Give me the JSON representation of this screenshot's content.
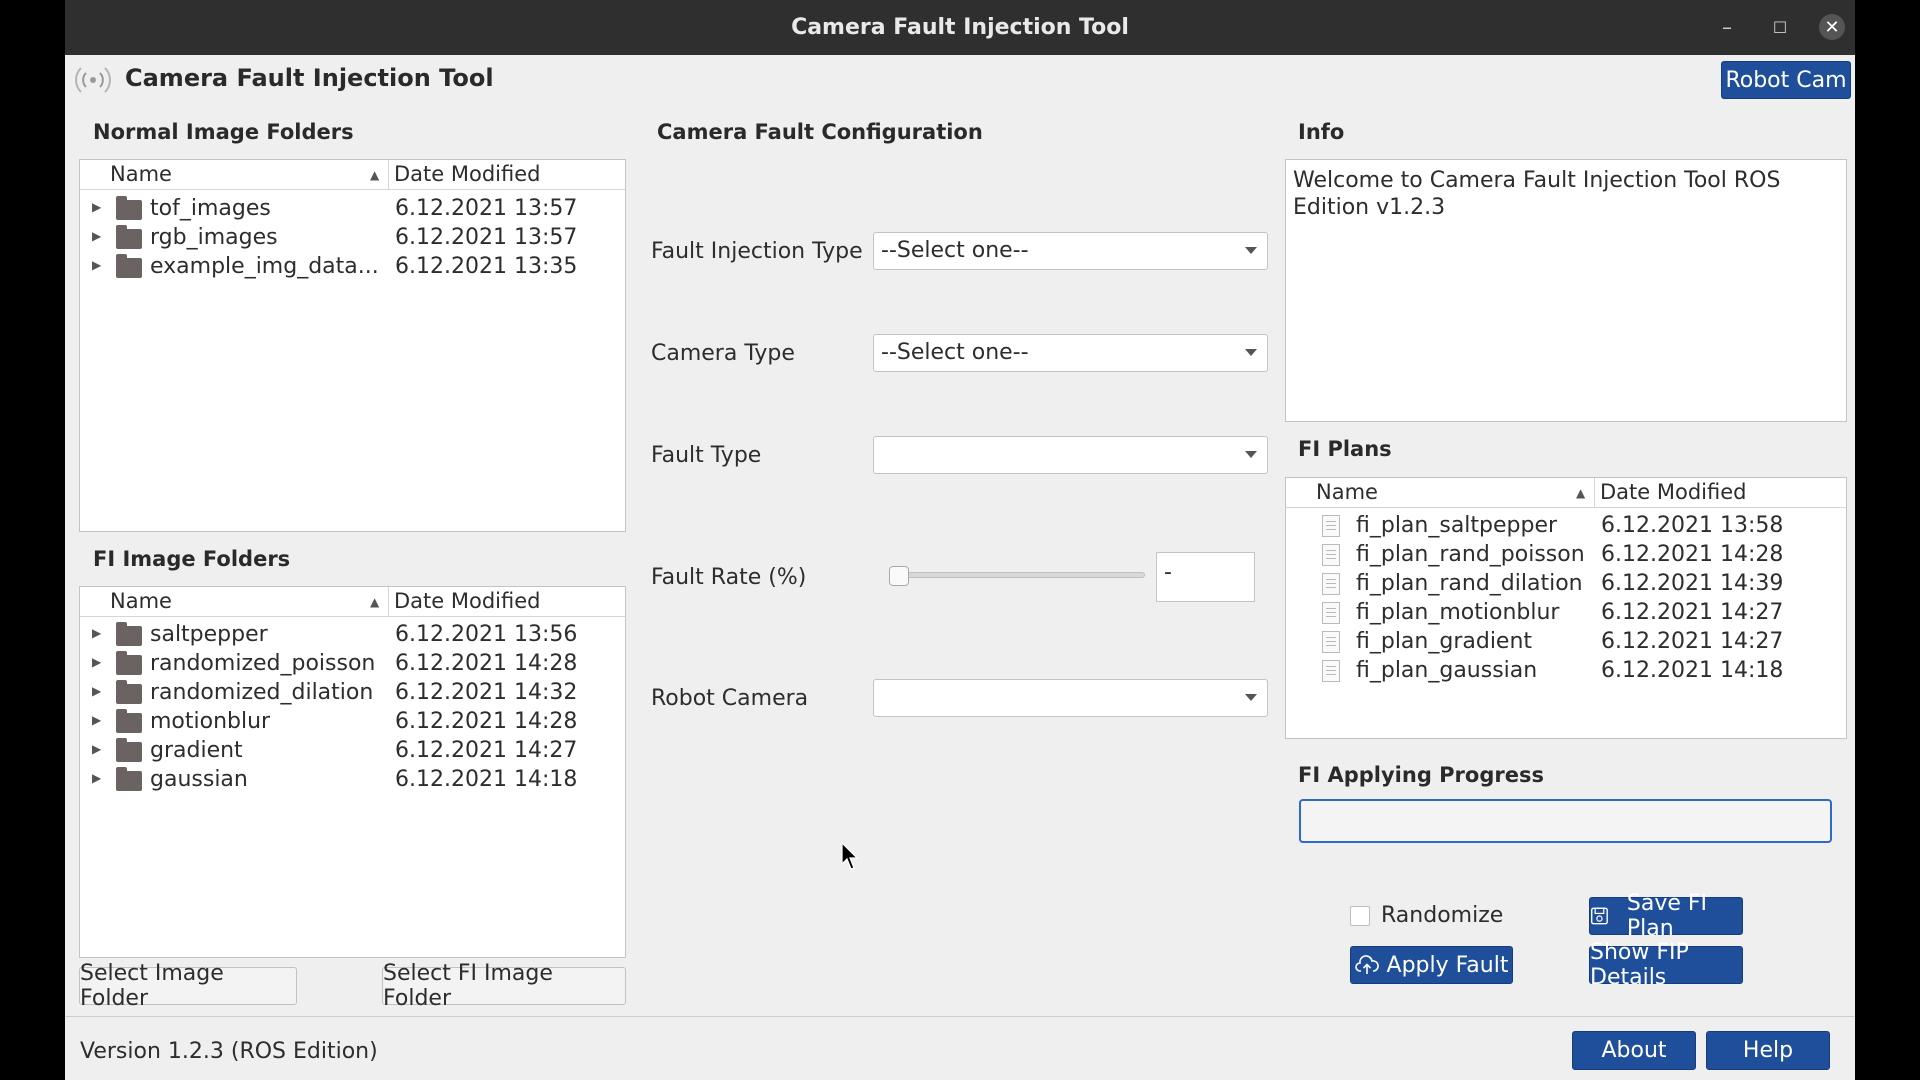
{
  "window": {
    "title": "Camera Fault Injection Tool",
    "minimize_glyph": "–",
    "maximize_glyph": "☐",
    "close_glyph": "✕"
  },
  "app": {
    "title": "Camera Fault Injection Tool",
    "robot_cam_button": "Robot Cam",
    "logo_icon": "signal-broadcast-icon"
  },
  "normal_folders": {
    "heading": "Normal Image Folders",
    "columns": [
      "Name",
      "Date Modified"
    ],
    "rows": [
      {
        "name": "tof_images",
        "date": "6.12.2021 13:57"
      },
      {
        "name": "rgb_images",
        "date": "6.12.2021 13:57"
      },
      {
        "name": "example_img_data...",
        "date": "6.12.2021 13:35"
      }
    ]
  },
  "fi_folders": {
    "heading": "FI Image Folders",
    "columns": [
      "Name",
      "Date Modified"
    ],
    "rows": [
      {
        "name": "saltpepper",
        "date": "6.12.2021 13:56"
      },
      {
        "name": "randomized_poisson",
        "date": "6.12.2021 14:28"
      },
      {
        "name": "randomized_dilation",
        "date": "6.12.2021 14:32"
      },
      {
        "name": "motionblur",
        "date": "6.12.2021 14:28"
      },
      {
        "name": "gradient",
        "date": "6.12.2021 14:27"
      },
      {
        "name": "gaussian",
        "date": "6.12.2021 14:18"
      }
    ]
  },
  "buttons": {
    "select_image_folder": "Select Image Folder",
    "select_fi_image_folder": "Select FI Image Folder",
    "save_fi_plan": "Save FI Plan",
    "apply_fault": "Apply Fault",
    "show_fip_details": "Show FIP Details",
    "about": "About",
    "help": "Help"
  },
  "config": {
    "heading": "Camera Fault Configuration",
    "fault_injection_type": {
      "label": "Fault Injection Type",
      "value": "--Select one--"
    },
    "camera_type": {
      "label": "Camera Type",
      "value": "--Select one--"
    },
    "fault_type": {
      "label": "Fault Type",
      "value": ""
    },
    "fault_rate": {
      "label": "Fault Rate (%)",
      "value": "-",
      "slider_fraction": 0
    },
    "robot_camera": {
      "label": "Robot Camera",
      "value": ""
    }
  },
  "info": {
    "heading": "Info",
    "text": "Welcome to Camera Fault Injection Tool ROS Edition v1.2.3"
  },
  "fi_plans": {
    "heading": "FI Plans",
    "columns": [
      "Name",
      "Date Modified"
    ],
    "rows": [
      {
        "name": "fi_plan_saltpepper",
        "date": "6.12.2021 13:58"
      },
      {
        "name": "fi_plan_rand_poisson",
        "date": "6.12.2021 14:28"
      },
      {
        "name": "fi_plan_rand_dilation",
        "date": "6.12.2021 14:39"
      },
      {
        "name": "fi_plan_motionblur",
        "date": "6.12.2021 14:27"
      },
      {
        "name": "fi_plan_gradient",
        "date": "6.12.2021 14:27"
      },
      {
        "name": "fi_plan_gaussian",
        "date": "6.12.2021 14:18"
      }
    ]
  },
  "progress": {
    "heading": "FI Applying Progress",
    "value_fraction": 0
  },
  "randomize": {
    "label": "Randomize",
    "checked": false
  },
  "footer": {
    "version": "Version 1.2.3 (ROS Edition)"
  },
  "colors": {
    "accent_blue": "#1f4f9a",
    "titlebar": "#2f2f2f",
    "window_bg": "#efefef"
  }
}
